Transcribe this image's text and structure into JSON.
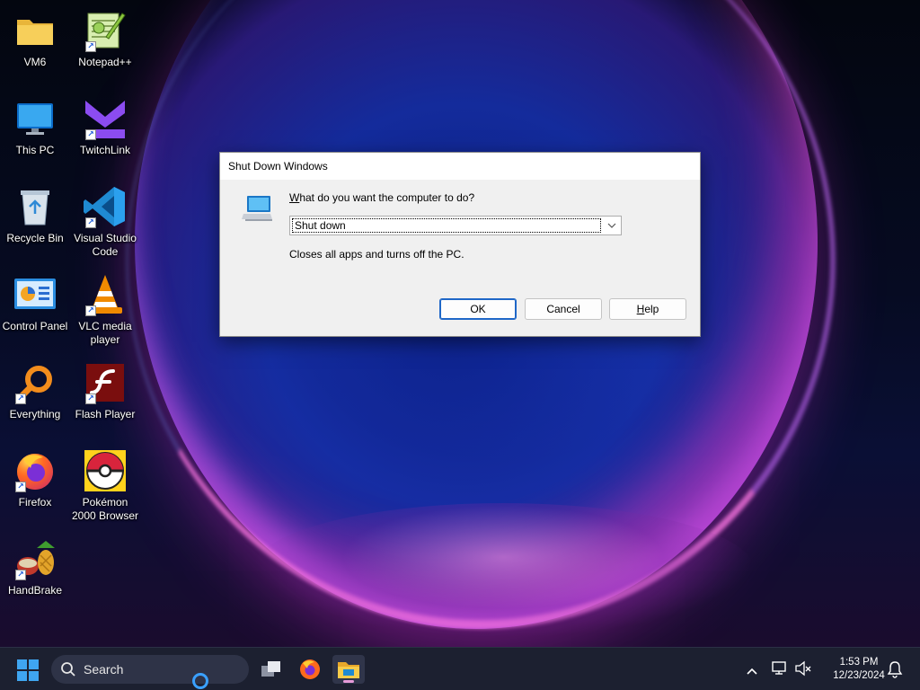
{
  "desktop": {
    "icons": [
      {
        "label": "VM6",
        "icon": "folder-icon"
      },
      {
        "label": "Notepad++",
        "icon": "notepadpp-icon"
      },
      {
        "label": "This PC",
        "icon": "this-pc-icon"
      },
      {
        "label": "TwitchLink",
        "icon": "twitchlink-icon"
      },
      {
        "label": "Recycle Bin",
        "icon": "recycle-bin-icon"
      },
      {
        "label": "Visual Studio Code",
        "icon": "vscode-icon"
      },
      {
        "label": "Control Panel",
        "icon": "control-panel-icon"
      },
      {
        "label": "VLC media player",
        "icon": "vlc-icon"
      },
      {
        "label": "Everything",
        "icon": "everything-icon"
      },
      {
        "label": "Flash Player",
        "icon": "flash-player-icon"
      },
      {
        "label": "Firefox",
        "icon": "firefox-icon"
      },
      {
        "label": "Pokémon 2000 Browser",
        "icon": "pokeball-icon"
      },
      {
        "label": "HandBrake",
        "icon": "handbrake-icon"
      }
    ]
  },
  "dialog": {
    "title": "Shut Down Windows",
    "prompt_mnemonic": "W",
    "prompt_rest": "hat do you want the computer to do?",
    "selected_option": "Shut down",
    "description": "Closes all apps and turns off the PC.",
    "ok_label": "OK",
    "cancel_label": "Cancel",
    "help_mnemonic": "H",
    "help_rest": "elp"
  },
  "taskbar": {
    "search_placeholder": "Search",
    "apps": [
      "task-view-icon",
      "firefox-icon",
      "file-explorer-icon"
    ],
    "active_app": "file-explorer-icon",
    "time": "1:53 PM",
    "date": "12/23/2024"
  },
  "colors": {
    "accent": "#1f67c7",
    "taskbar_bg": "#1c2030",
    "dialog_bg": "#f0f0f0"
  }
}
